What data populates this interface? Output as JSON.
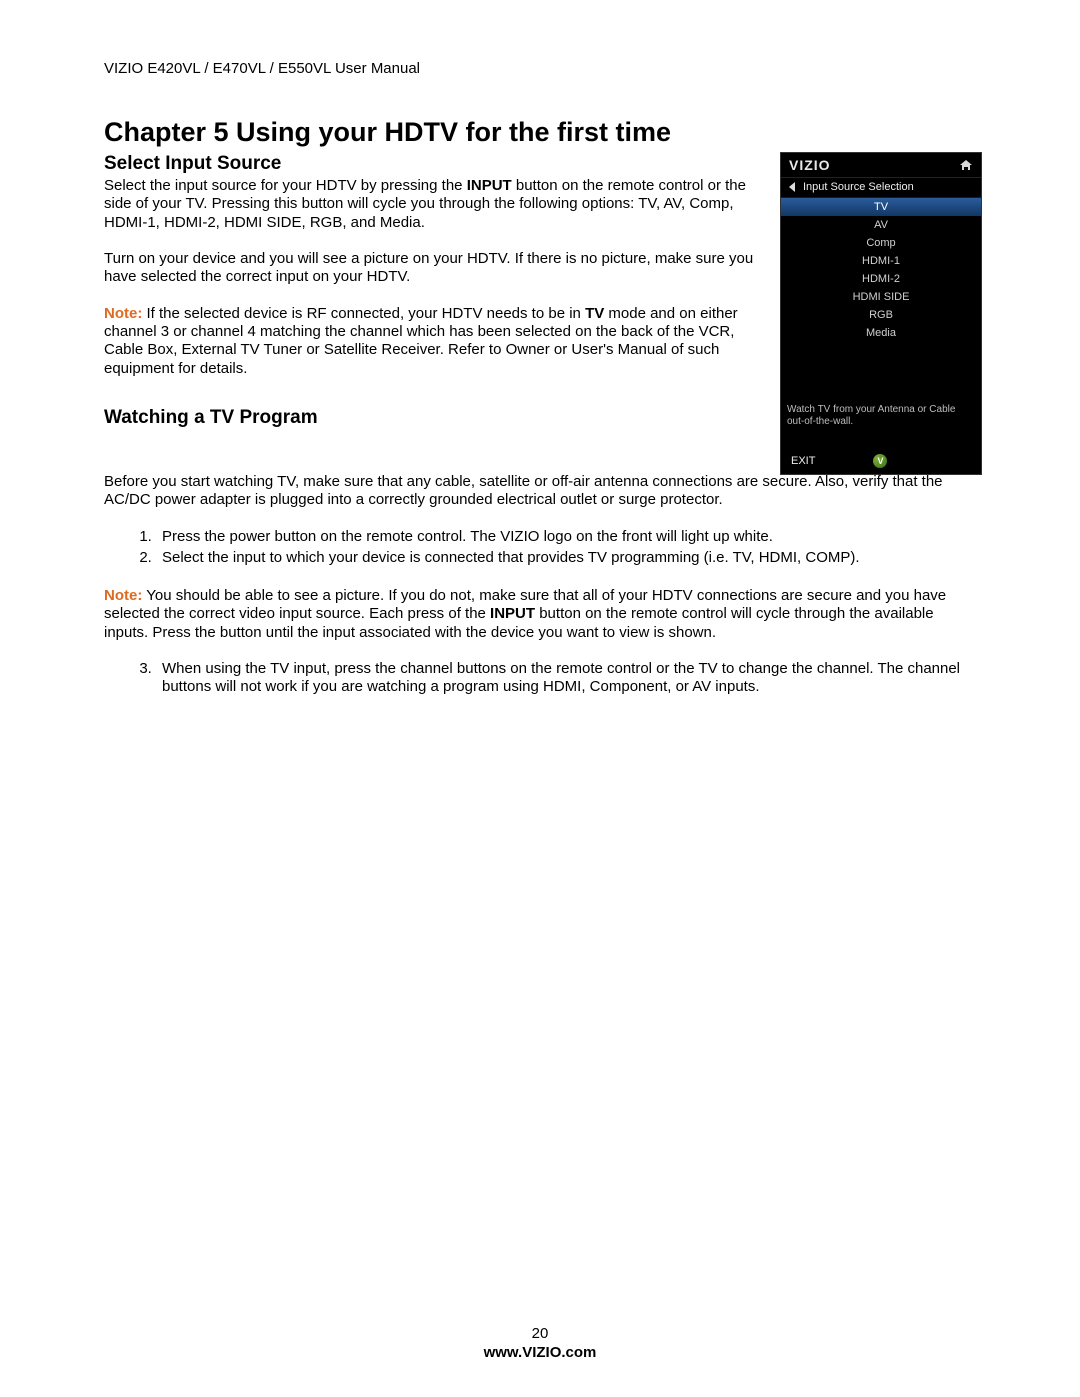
{
  "header": "VIZIO E420VL / E470VL / E550VL User Manual",
  "chapter_title": "Chapter 5 Using your HDTV for the first time",
  "section1": {
    "heading": "Select Input Source",
    "p1_a": "Select the input source for your HDTV by pressing the ",
    "p1_bold": "INPUT",
    "p1_b": " button on the remote control or the side of your TV.  Pressing this button will cycle you through the following options: TV, AV, Comp, HDMI-1, HDMI-2, HDMI SIDE, RGB, and Media.",
    "p2": "Turn on your device and you will see a picture on your HDTV. If there is no picture, make sure you have selected the correct input on your HDTV.",
    "note_label": "Note:",
    "p3_a": " If the selected device is RF connected, your HDTV needs to be in ",
    "p3_bold": "TV",
    "p3_b": " mode and on either channel 3 or channel 4 matching the channel which has been selected on the back of the VCR, Cable Box, External TV Tuner or Satellite Receiver. Refer to Owner or User's Manual of such equipment for details."
  },
  "section2": {
    "heading": "Watching a TV Program",
    "intro": "Before you start watching TV, make sure that any cable, satellite or off-air antenna connections are secure. Also, verify that the AC/DC power adapter is plugged into a correctly grounded electrical outlet or surge protector.",
    "steps_a": [
      "Press the power button on the remote control.  The VIZIO logo on the front will light up white.",
      "Select the input to which your device is connected that provides TV programming (i.e. TV, HDMI, COMP)."
    ],
    "note_label": "Note:",
    "note_a": " You should be able to see a picture.  If you do not, make sure that all of your HDTV connections are secure and you have selected the correct video input source. Each press of the ",
    "note_bold": "INPUT",
    "note_b": " button on the remote control will cycle through the available inputs. Press the button until the input associated with the device you want to view is shown.",
    "steps_b": [
      "When using the TV input, press the channel buttons on the remote control or the TV to change the channel. The channel buttons will not work if you are watching a program using HDMI, Component, or AV inputs."
    ]
  },
  "osd": {
    "logo": "VIZIO",
    "title": "Input Source Selection",
    "items": [
      "TV",
      "AV",
      "Comp",
      "HDMI-1",
      "HDMI-2",
      "HDMI SIDE",
      "RGB",
      "Media"
    ],
    "selected_index": 0,
    "description": "Watch TV from your Antenna or Cable out-of-the-wall.",
    "exit": "EXIT",
    "v_badge": "V"
  },
  "footer": {
    "page_number": "20",
    "site": "www.VIZIO.com"
  }
}
